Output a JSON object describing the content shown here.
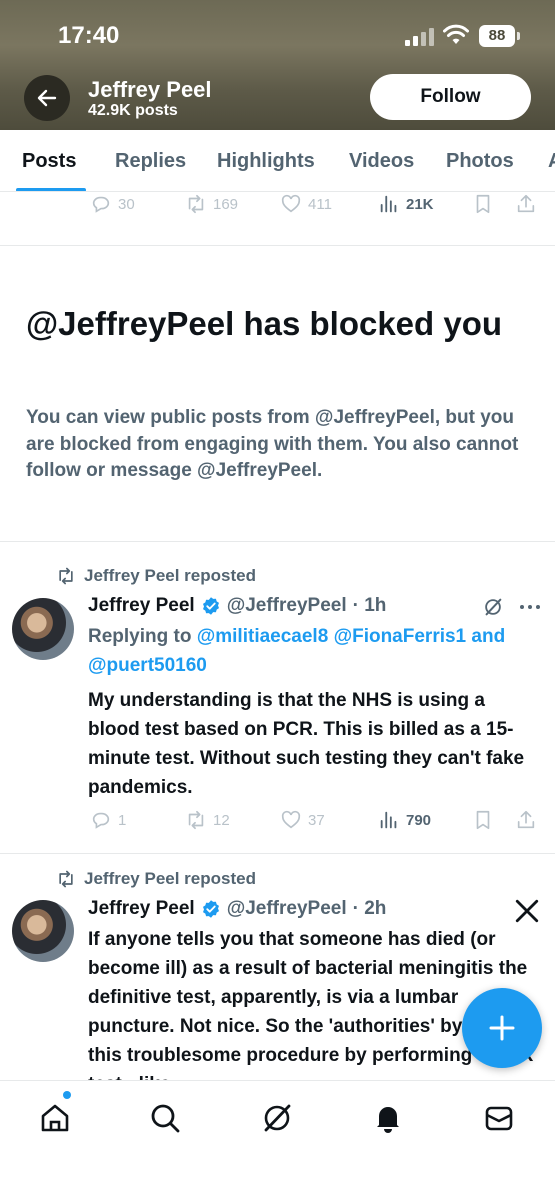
{
  "status_bar": {
    "time": "17:40",
    "battery": "88"
  },
  "header": {
    "name": "Jeffrey Peel",
    "posts_count": "42.9K posts",
    "follow_label": "Follow"
  },
  "tabs": [
    "Posts",
    "Replies",
    "Highlights",
    "Videos",
    "Photos"
  ],
  "top_actions": {
    "replies": "30",
    "reposts": "169",
    "likes": "411",
    "views": "21K"
  },
  "blocked": {
    "title": "@JeffreyPeel has blocked you",
    "body": "You can view public posts from @JeffreyPeel, but you are blocked from engaging with them. You also cannot follow or message @JeffreyPeel."
  },
  "posts": [
    {
      "repost_label": "Jeffrey Peel reposted",
      "name": "Jeffrey Peel",
      "handle": "@JeffreyPeel",
      "time": "· 1h",
      "reply_prefix": "Replying to",
      "mention_1": "@militiaecael8",
      "mention_2": "@FionaFerris1",
      "reply_and": "and",
      "mention_3": "@puert50160",
      "text": "My understanding is that the NHS is using a blood test based on PCR.  This is billed as a 15-minute test. Without such testing they can't fake pandemics.",
      "replies": "1",
      "reposts": "12",
      "likes": "37",
      "views": "790"
    },
    {
      "repost_label": "Jeffrey Peel reposted",
      "name": "Jeffrey Peel",
      "handle": "@JeffreyPeel",
      "time": "· 2h",
      "text": "If anyone tells you that someone has died (or become ill) as a result of bacterial meningitis the definitive test, apparently, is via a lumbar puncture. Not nice. So the 'authorities' bypass this troublesome procedure by performing a PCR test - like"
    }
  ],
  "icons": {
    "back": "arrow-left-icon",
    "repost": "repost-icon",
    "reply": "reply-icon",
    "like": "heart-icon",
    "views": "views-icon",
    "bookmark": "bookmark-icon",
    "share": "share-icon",
    "grok": "grok-icon",
    "more": "more-icon",
    "x_logo": "x-logo-icon",
    "compose": "plus-icon"
  },
  "colors": {
    "accent": "#1d9bf0",
    "text": "#0f1419",
    "muted": "#536471"
  }
}
